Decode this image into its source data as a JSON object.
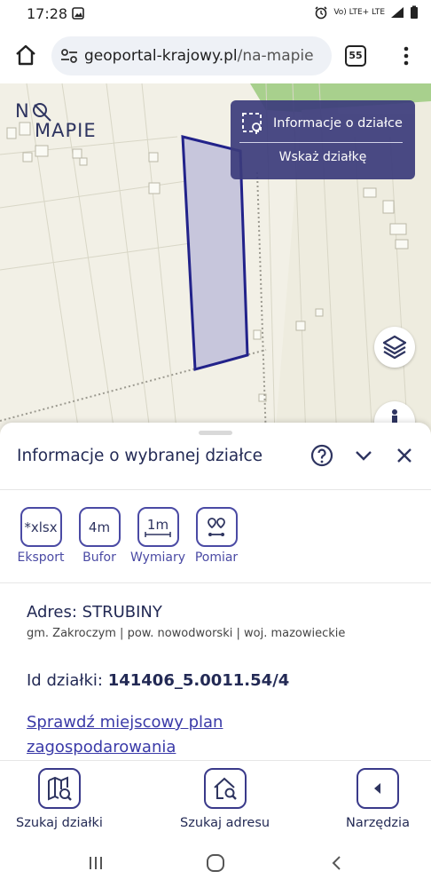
{
  "status": {
    "time": "17:28",
    "network": "Vo) LTE+ LTE"
  },
  "browser": {
    "url_domain": "geoportal-krajowy.pl",
    "url_path": "/na-mapie",
    "tab_count": "55"
  },
  "map": {
    "logo_text_top": "N  ",
    "logo_text_bottom": "MAPIE",
    "info_panel": {
      "title": "Informacje o działce",
      "action": "Wskaż działkę"
    }
  },
  "sheet": {
    "title": "Informacje o wybranej działce",
    "tools": [
      {
        "icon_text": "*xlsx",
        "label": "Eksport"
      },
      {
        "icon_text": "4m",
        "label": "Bufor"
      },
      {
        "icon_text": "1m",
        "label": "Wymiary"
      },
      {
        "icon_text": "",
        "label": "Pomiar"
      }
    ],
    "address_label": "Adres: STRUBINY",
    "address_sub": "gm. Zakroczym | pow. nowodworski | woj. mazowieckie",
    "id_label": "Id działki:",
    "id_value": "141406_5.0011.54/4",
    "plan_link": "Sprawdź miejscowy plan zagospodarowania"
  },
  "bottom_nav": [
    {
      "label": "Szukaj działki"
    },
    {
      "label": "Szukaj adresu"
    },
    {
      "label": "Narzędzia"
    }
  ],
  "colors": {
    "accent": "#3c3c7c",
    "parcel_fill": "#b8b8d8",
    "parcel_stroke": "#22228a"
  }
}
